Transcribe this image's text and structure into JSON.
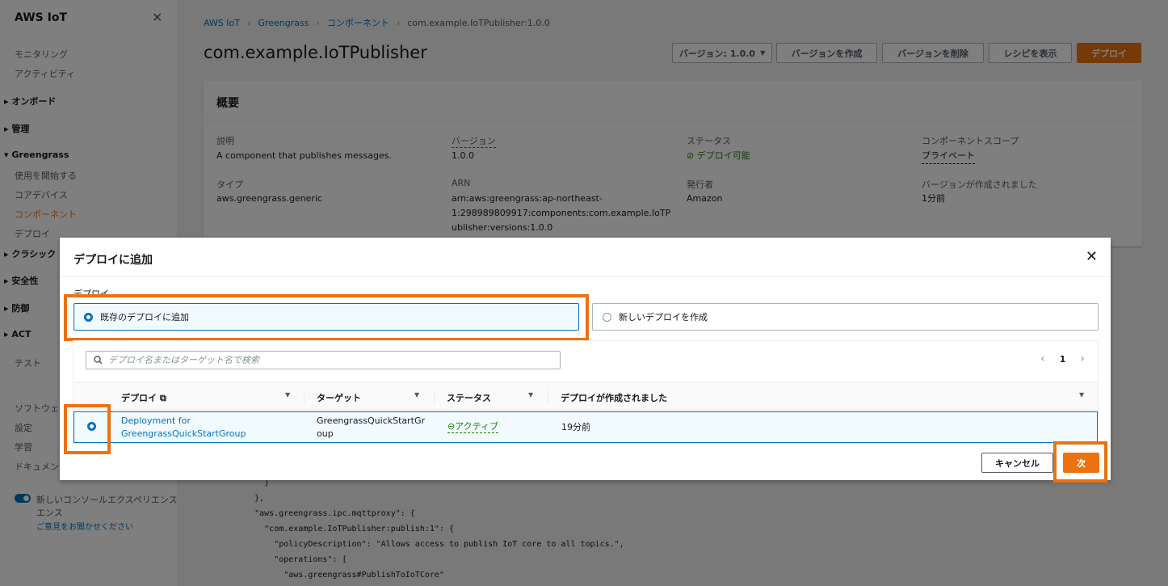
{
  "sidebar": {
    "title": "AWS IoT",
    "items": [
      {
        "label": "モニタリング"
      },
      {
        "label": "アクティビティ"
      },
      {
        "label": "オンボード"
      },
      {
        "label": "管理"
      },
      {
        "label": "Greengrass"
      },
      {
        "label": "使用を開始する"
      },
      {
        "label": "コアデバイス"
      },
      {
        "label": "コンポーネント"
      },
      {
        "label": "デプロイ"
      },
      {
        "label": "クラシック"
      },
      {
        "label": "安全性"
      },
      {
        "label": "防御"
      },
      {
        "label": "ACT"
      },
      {
        "label": "テスト"
      },
      {
        "label": "ソフトウェア"
      },
      {
        "label": "設定"
      },
      {
        "label": "学習"
      },
      {
        "label": "ドキュメント"
      }
    ],
    "console_toggle_label": "新しいコンソールエクスペリエンス",
    "console_toggle_label_2": "エンス",
    "feedback_link": "ご意見をお聞かせください"
  },
  "breadcrumb": [
    "AWS IoT",
    "Greengrass",
    "コンポーネント",
    "com.example.IoTPublisher:1.0.0"
  ],
  "page": {
    "title": "com.example.IoTPublisher",
    "version_select": "バージョン: 1.0.0",
    "create_version": "バージョンを作成",
    "delete_version": "バージョンを削除",
    "view_recipe": "レシピを表示",
    "deploy": "デプロイ"
  },
  "overview": {
    "heading": "概要",
    "fields": {
      "description": {
        "label": "説明",
        "value": "A component that publishes messages."
      },
      "version": {
        "label": "バージョン",
        "value": "1.0.0"
      },
      "status": {
        "label": "ステータス",
        "value": "デプロイ可能"
      },
      "scope": {
        "label": "コンポーネントスコープ",
        "value": "プライベート"
      },
      "type": {
        "label": "タイプ",
        "value": "aws.greengrass.generic"
      },
      "arn": {
        "label": "ARN",
        "value_1": "arn:aws:greengrass:ap-northeast-",
        "value_2": "1:298989809917:components:com.example.IoTP",
        "value_3": "ublisher:versions:1.0.0"
      },
      "publisher": {
        "label": "発行者",
        "value": "Amazon"
      },
      "created": {
        "label": "バージョンが作成されました",
        "value": "1分前"
      }
    }
  },
  "code_lines": [
    "        }",
    "      },",
    "      \"aws.greengrass.ipc.mqttproxy\": {",
    "        \"com.example.IoTPublisher:publish:1\": {",
    "          \"policyDescription\": \"Allows access to publish IoT core to all topics.\",",
    "          \"operations\": [",
    "            \"aws.greengrass#PublishToIoTCore\""
  ],
  "modal": {
    "title": "デプロイに追加",
    "field_label": "デプロイ",
    "option_existing": "既存のデプロイに追加",
    "option_new": "新しいデプロイを作成",
    "search_placeholder": "デプロイ名またはターゲット名で検索",
    "page_number": "1",
    "columns": [
      "デプロイ",
      "ターゲット",
      "ステータス",
      "デプロイが作成されました"
    ],
    "rows": [
      {
        "deployment_1": "Deployment for",
        "deployment_2": "GreengrassQuickStartGroup",
        "target_1": "GreengrassQuickStartGr",
        "target_2": "oup",
        "status": "アクティブ",
        "created": "19分前"
      }
    ],
    "cancel": "キャンセル",
    "next": "次"
  },
  "colors": {
    "accent": "#ec7211",
    "link": "#0073bb",
    "success": "#1d8102"
  }
}
